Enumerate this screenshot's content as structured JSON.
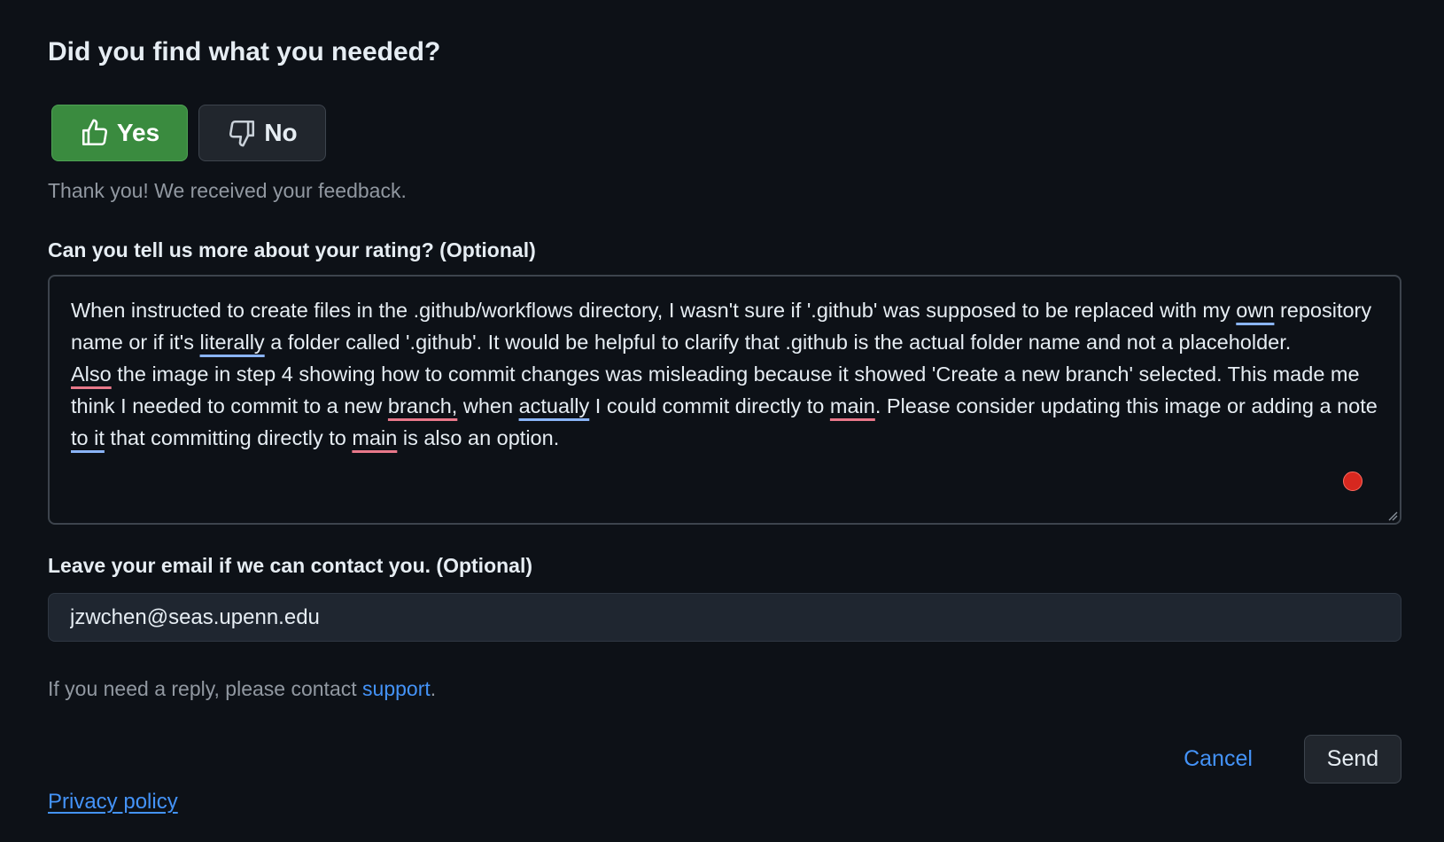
{
  "feedback": {
    "heading": "Did you find what you needed?",
    "yes_label": "Yes",
    "no_label": "No",
    "thanks_message": "Thank you! We received your feedback."
  },
  "rating_details": {
    "label": "Can you tell us more about your rating? (Optional)",
    "paragraph1": [
      {
        "text": "When instructed to create files in the .github/workflows directory, I wasn't sure if '.github' was supposed to be replaced with my "
      },
      {
        "text": "own",
        "mark": "blue"
      },
      {
        "text": " repository name or if it's "
      },
      {
        "text": "literally",
        "mark": "blue"
      },
      {
        "text": " a folder called '.github'. It would be helpful to clarify that .github is the actual folder name and not a placeholder."
      }
    ],
    "paragraph2": [
      {
        "text": "Also",
        "mark": "red"
      },
      {
        "text": " the image in step 4 showing how to commit changes was misleading because it showed 'Create a new branch' selected. This made me think I needed to commit to a new "
      },
      {
        "text": "branch,",
        "mark": "red"
      },
      {
        "text": " when "
      },
      {
        "text": "actually",
        "mark": "blue"
      },
      {
        "text": " I could commit directly to "
      },
      {
        "text": "main",
        "mark": "red"
      },
      {
        "text": ". Please consider updating this image or adding a note "
      },
      {
        "text": "to it",
        "mark": "blue"
      },
      {
        "text": " that committing directly to "
      },
      {
        "text": "main",
        "mark": "red"
      },
      {
        "text": " is also an option."
      }
    ]
  },
  "email": {
    "label": "Leave your email if we can contact you. (Optional)",
    "value": "jzwchen@seas.upenn.edu"
  },
  "reply_note": {
    "prefix": "If you need a reply, please contact ",
    "link_text": "support",
    "suffix": "."
  },
  "actions": {
    "cancel_label": "Cancel",
    "send_label": "Send"
  },
  "footer": {
    "privacy_label": "Privacy policy"
  },
  "icons": {
    "yes": "thumbs-up-icon",
    "no": "thumbs-down-icon"
  },
  "colors": {
    "background": "#0d1117",
    "yes_button": "#3a8b3f",
    "link": "#4493f8",
    "record_indicator": "#d7281f"
  }
}
